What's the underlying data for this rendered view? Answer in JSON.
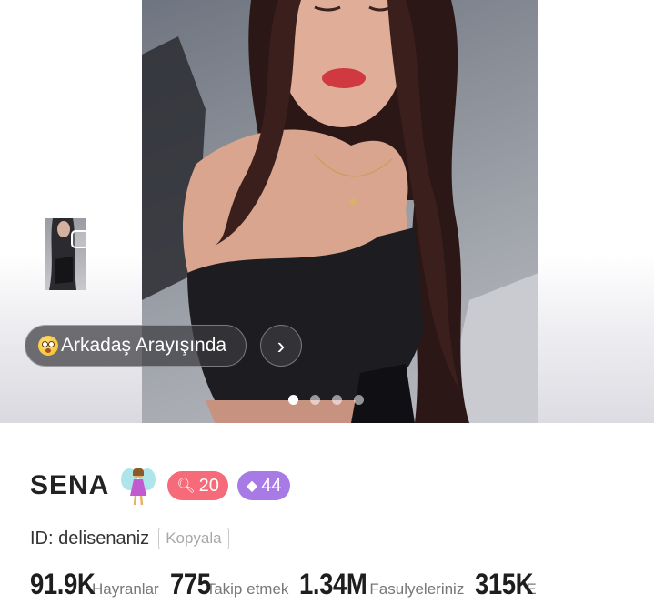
{
  "profile": {
    "status_text": "Arkadaş Arayışında",
    "name": "SENA",
    "level_badge": "20",
    "vip_badge": "44",
    "id_text": "ID: delisenaniz",
    "copy_label": "Kopyala",
    "stats": [
      {
        "value": "91.9K",
        "label": "Hayranlar"
      },
      {
        "value": "775",
        "label": "Takip etmek"
      },
      {
        "value": "1.34M",
        "label": "Fasulyeleriniz"
      },
      {
        "value": "315K",
        "label": "E"
      }
    ]
  },
  "carousel": {
    "slide_count": 4,
    "active_index": 0
  },
  "icons": {
    "status": "flushed-face-emoji-icon",
    "next": "chevron-right-icon",
    "fairy": "fairy-emoji-icon",
    "level": "search-icon",
    "vip": "diamond-icon",
    "thumb": "multi-photo-icon"
  },
  "colors": {
    "level_badge": "#f56b7a",
    "vip_badge": "#a77ae6",
    "pill_bg": "#3c3c40"
  }
}
